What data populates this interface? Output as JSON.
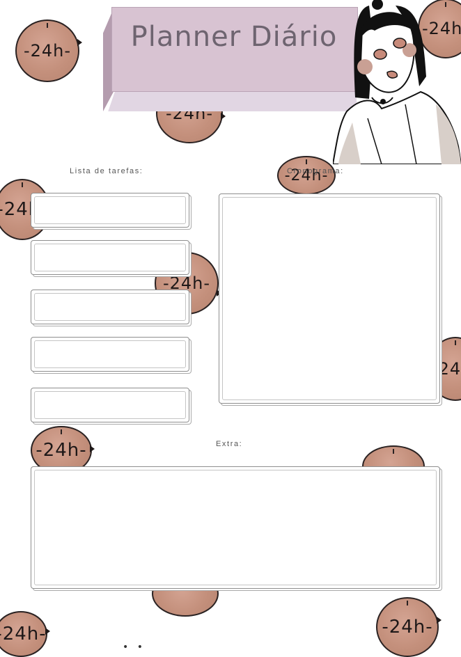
{
  "header": {
    "title": "Planner Diário"
  },
  "clock_label": "24h",
  "sections": {
    "tasks_label": "Lista de tarefas:",
    "schedule_label": "Cronograma:",
    "extra_label": "Extra:"
  },
  "task_count": 5,
  "colors": {
    "title_block": "#d8c3d2",
    "title_side": "#b49cae",
    "title_text": "#6e6470",
    "clock_fill": "#c4907c",
    "box_border": "#8e8e8e"
  },
  "icons": [
    "clock-icon",
    "girl-illustration"
  ]
}
